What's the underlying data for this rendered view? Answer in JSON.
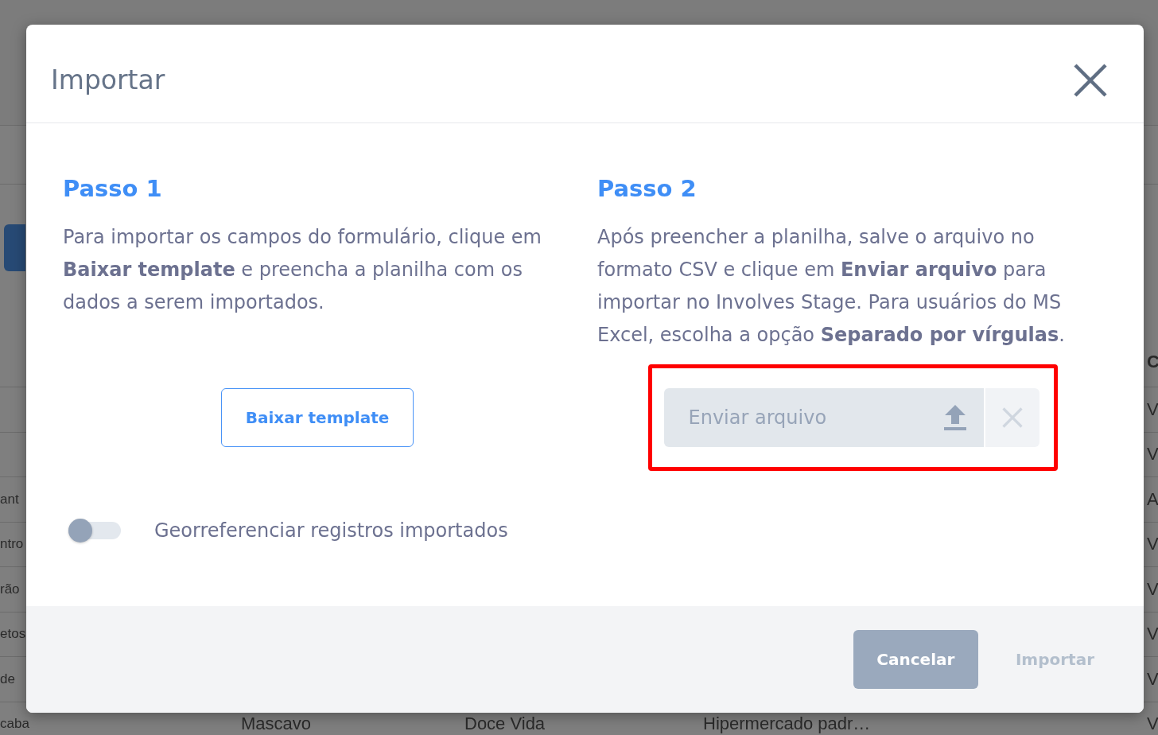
{
  "background": {
    "table": {
      "header": {
        "column_5": "C"
      },
      "rows": [
        {
          "column_5": "V"
        },
        {
          "column_5": "V"
        },
        {
          "column_1": "ant",
          "column_5": "A"
        },
        {
          "column_1": "ntro",
          "column_5": "V"
        },
        {
          "column_1": "rão",
          "column_5": "V"
        },
        {
          "column_1": "etos",
          "column_5": "V"
        },
        {
          "column_1": "de",
          "column_5": "V"
        },
        {
          "column_1": "caba",
          "column_2": "Mascavo",
          "column_3": "Doce Vida",
          "column_4": "Hipermercado padr…",
          "column_5": "V"
        }
      ]
    }
  },
  "dialog": {
    "title": "Importar",
    "steps": [
      {
        "title": "Passo 1",
        "text": "Para importar os campos do formulário, clique em **Baixar template** e preencha a planilha com os dados a serem importados.",
        "download_button": {
          "label": "Baixar template"
        },
        "toggle": {
          "label": "Georreferenciar registros importados",
          "on": false
        }
      },
      {
        "title": "Passo 2",
        "text": "Após preencher a planilha, salve o arquivo no formato CSV e clique em **Enviar arquivo** para importar no Involves Stage. Para usuários do MS Excel, escolha a opção **Separado por vírgulas**.",
        "upload_field": {
          "placeholder": "Enviar arquivo",
          "highlighted": true
        },
        "clear_button": {
          "disabled": true
        }
      }
    ],
    "footer_buttons": [
      {
        "label": "Cancelar",
        "kind": "filled",
        "disabled": false
      },
      {
        "label": "Importar",
        "kind": "text",
        "disabled": true
      }
    ]
  }
}
